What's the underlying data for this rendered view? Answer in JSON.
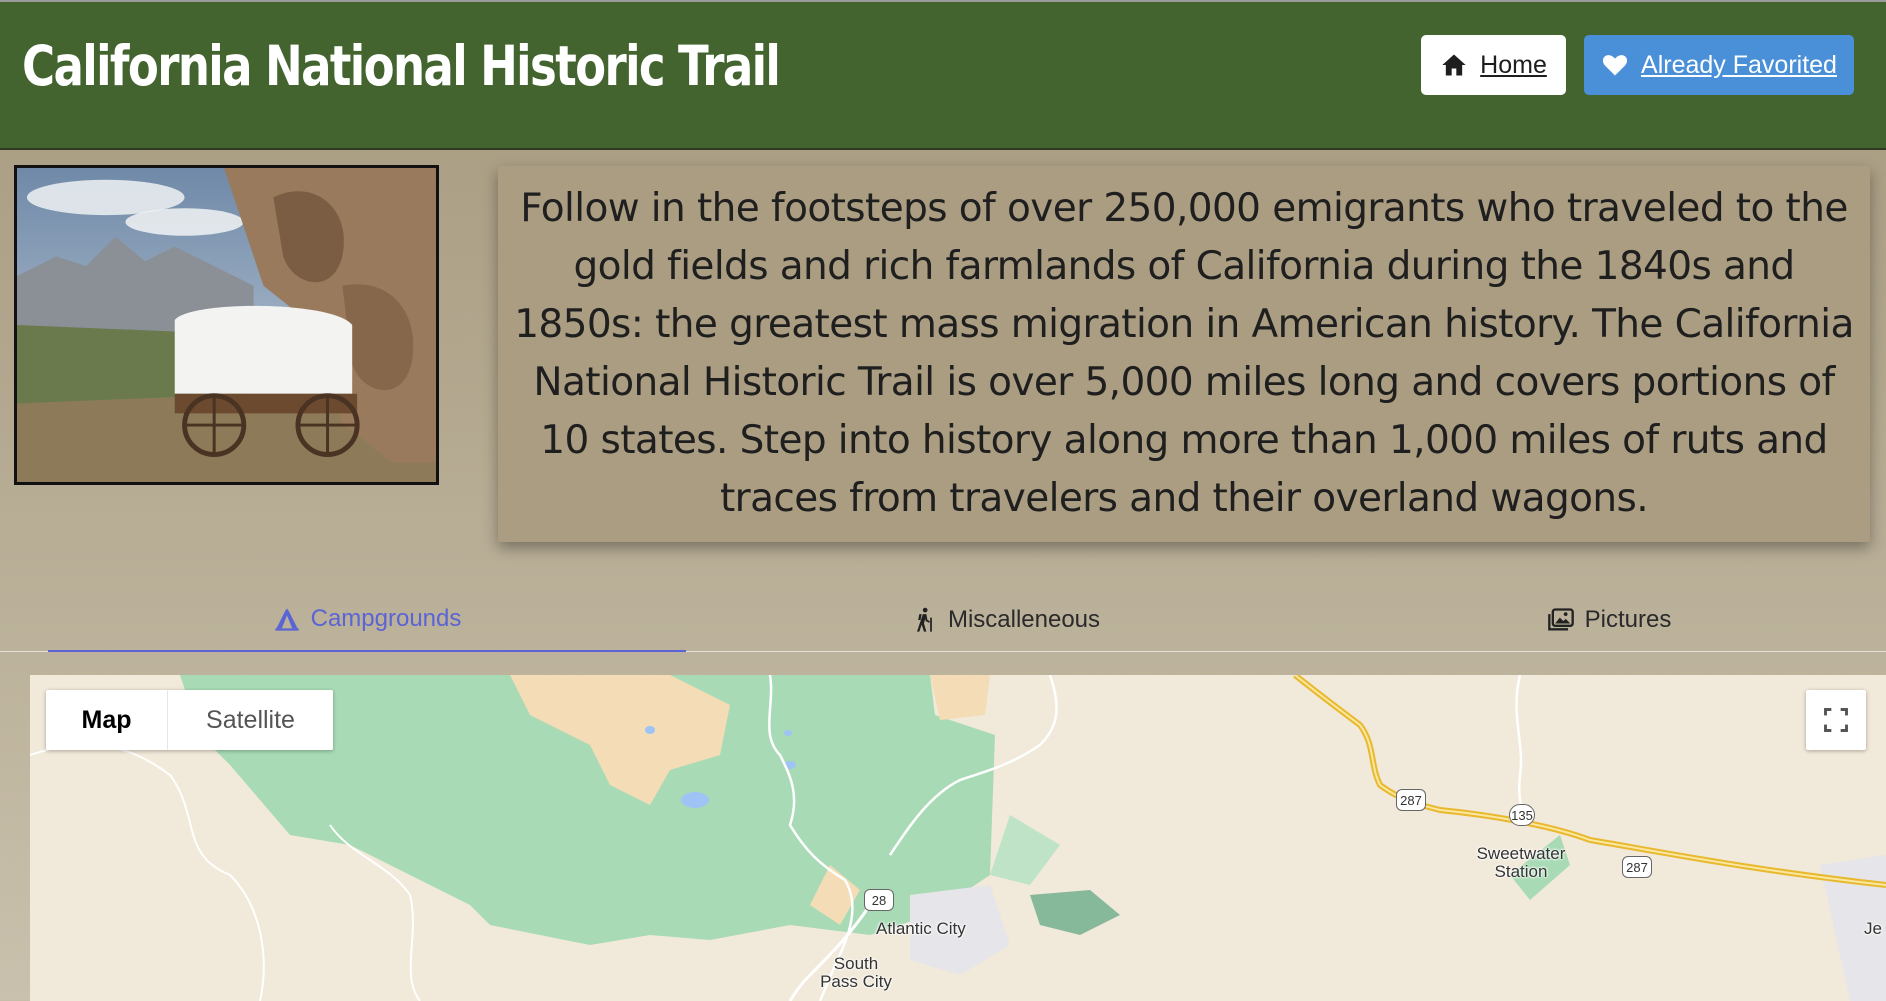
{
  "header": {
    "title": "California National Historic Trail",
    "home_label": "Home",
    "favorite_label": "Already Favorited",
    "favorite_color": "#4a90d9",
    "header_color": "#44642f"
  },
  "intro": {
    "text": "Follow in the footsteps of over 250,000 emigrants who traveled to the gold fields and rich farmlands of California during the 1840s and 1850s: the greatest mass migration in American history. The California National Historic Trail is over 5,000 miles long and covers portions of 10 states. Step into history along more than 1,000 miles of ruts and traces from travelers and their overland wagons."
  },
  "tabs": [
    {
      "label": "Campgrounds",
      "icon": "tent-icon",
      "active": true
    },
    {
      "label": "Miscalleneous",
      "icon": "hiker-icon",
      "active": false
    },
    {
      "label": "Pictures",
      "icon": "images-icon",
      "active": false
    }
  ],
  "map": {
    "type_map": "Map",
    "type_satellite": "Satellite",
    "selected_type": "Map",
    "places": {
      "atlantic_city": "Atlantic City",
      "south_pass_city_1": "South",
      "south_pass_city_2": "Pass City",
      "sweetwater_1": "Sweetwater",
      "sweetwater_2": "Station",
      "partial": "Je"
    },
    "routes": {
      "r28": "28",
      "r287a": "287",
      "r135": "135",
      "r287b": "287"
    }
  }
}
